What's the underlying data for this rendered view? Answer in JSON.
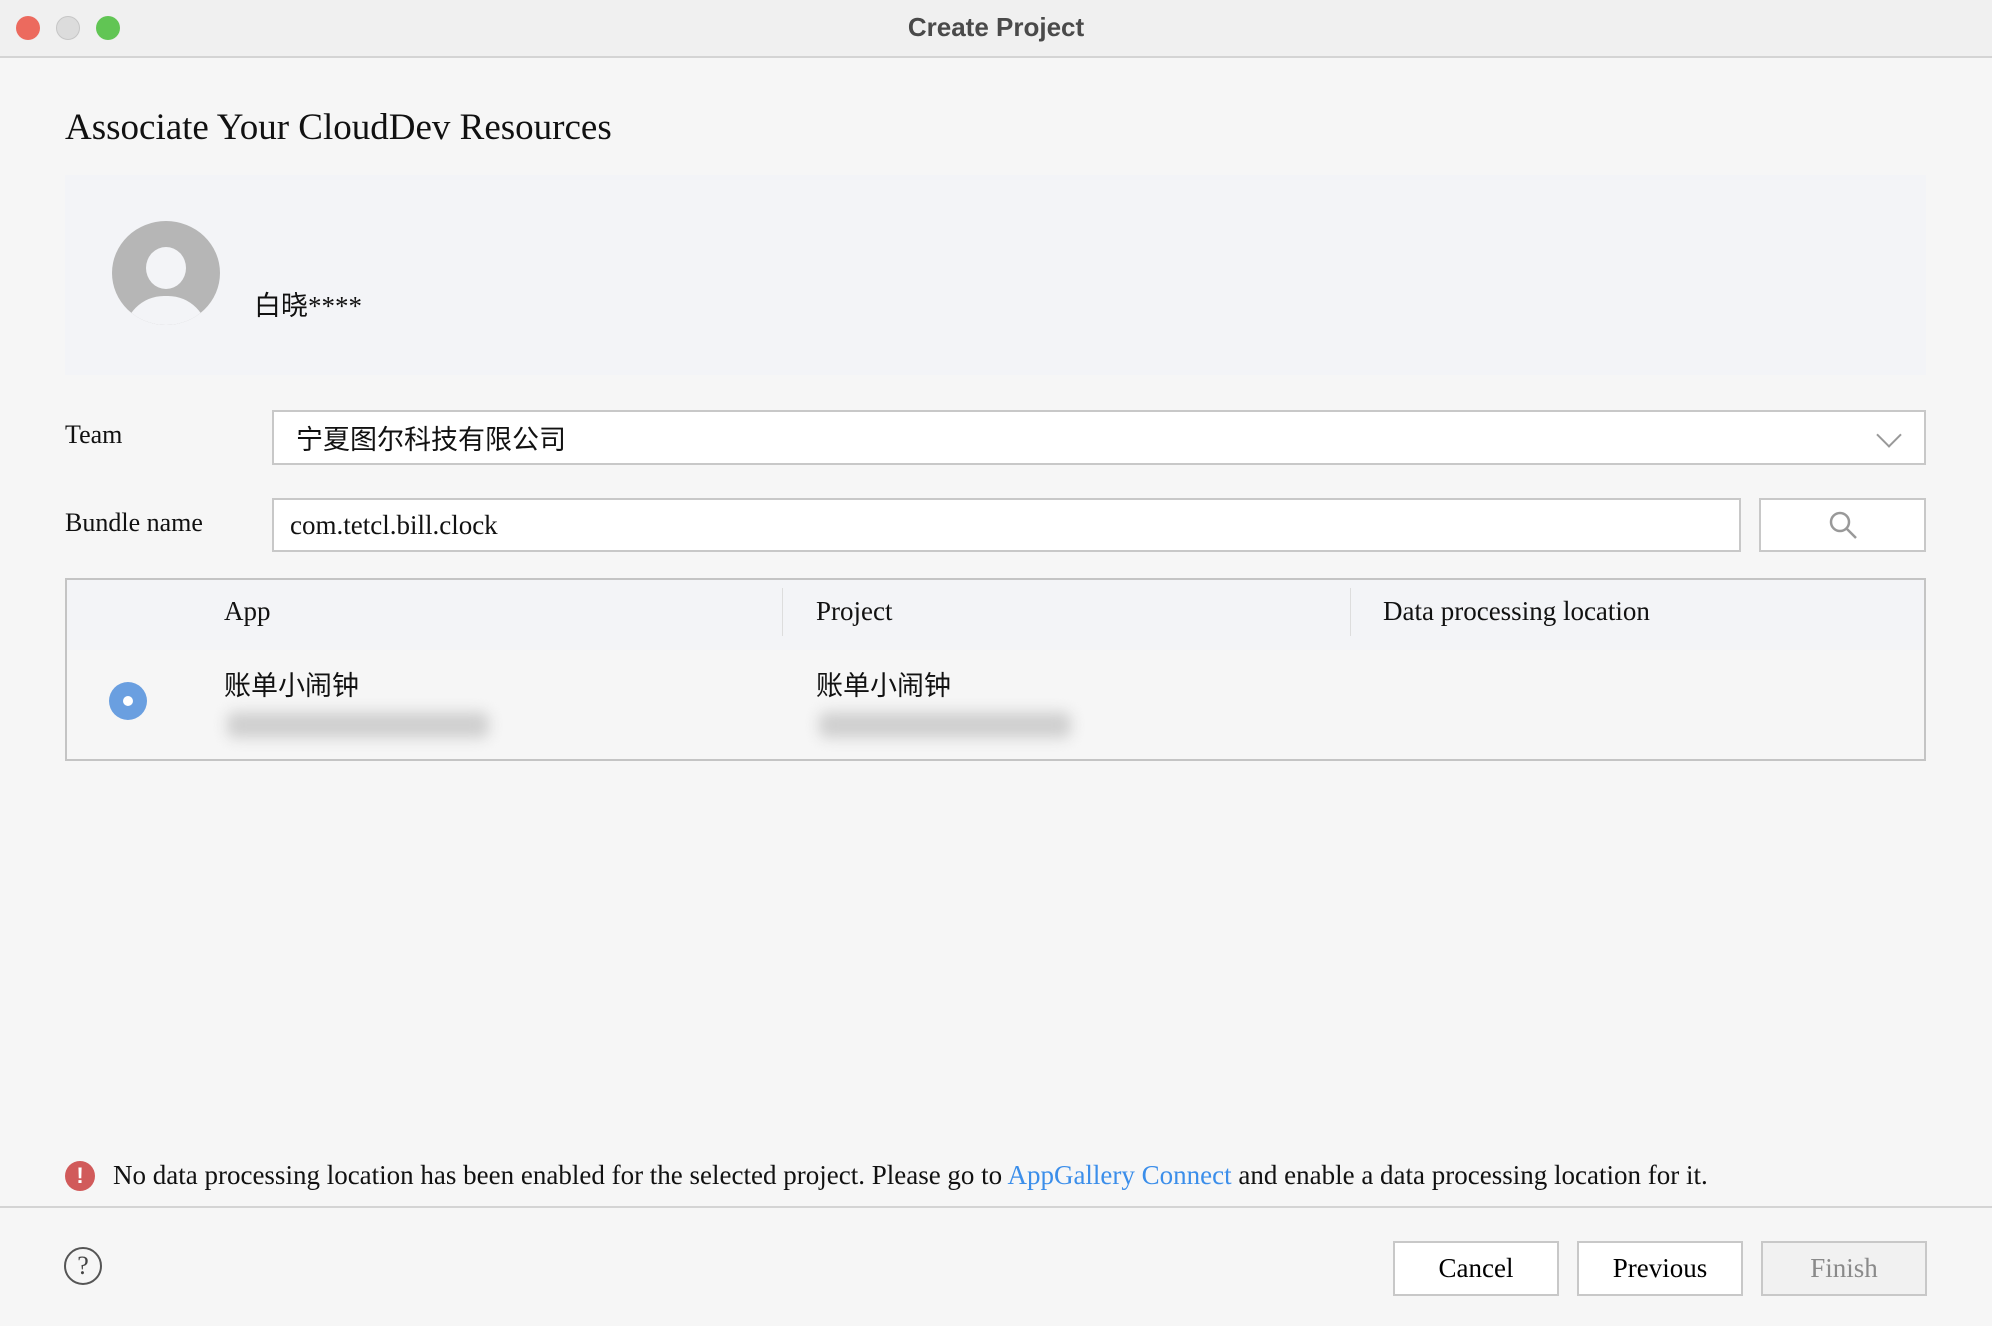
{
  "window": {
    "title": "Create Project"
  },
  "heading": "Associate Your CloudDev Resources",
  "user": {
    "name": "白晓****"
  },
  "team": {
    "label": "Team",
    "value": "宁夏图尔科技有限公司"
  },
  "bundle": {
    "label": "Bundle name",
    "value": "com.tetcl.bill.clock"
  },
  "table": {
    "columns": [
      "App",
      "Project",
      "Data processing location"
    ],
    "rows": [
      {
        "app": "账单小闹钟",
        "project": "账单小闹钟",
        "location": "",
        "selected": true
      }
    ]
  },
  "warning": {
    "before": "No data processing location has been enabled for the selected project. Please go to ",
    "link": "AppGallery Connect",
    "after": " and enable a data processing location for it."
  },
  "buttons": {
    "cancel": "Cancel",
    "previous": "Previous",
    "finish": "Finish"
  },
  "help": "?",
  "colors": {
    "accent": "#6a9fe0",
    "link": "#3b8eea",
    "error": "#d15a5a"
  }
}
